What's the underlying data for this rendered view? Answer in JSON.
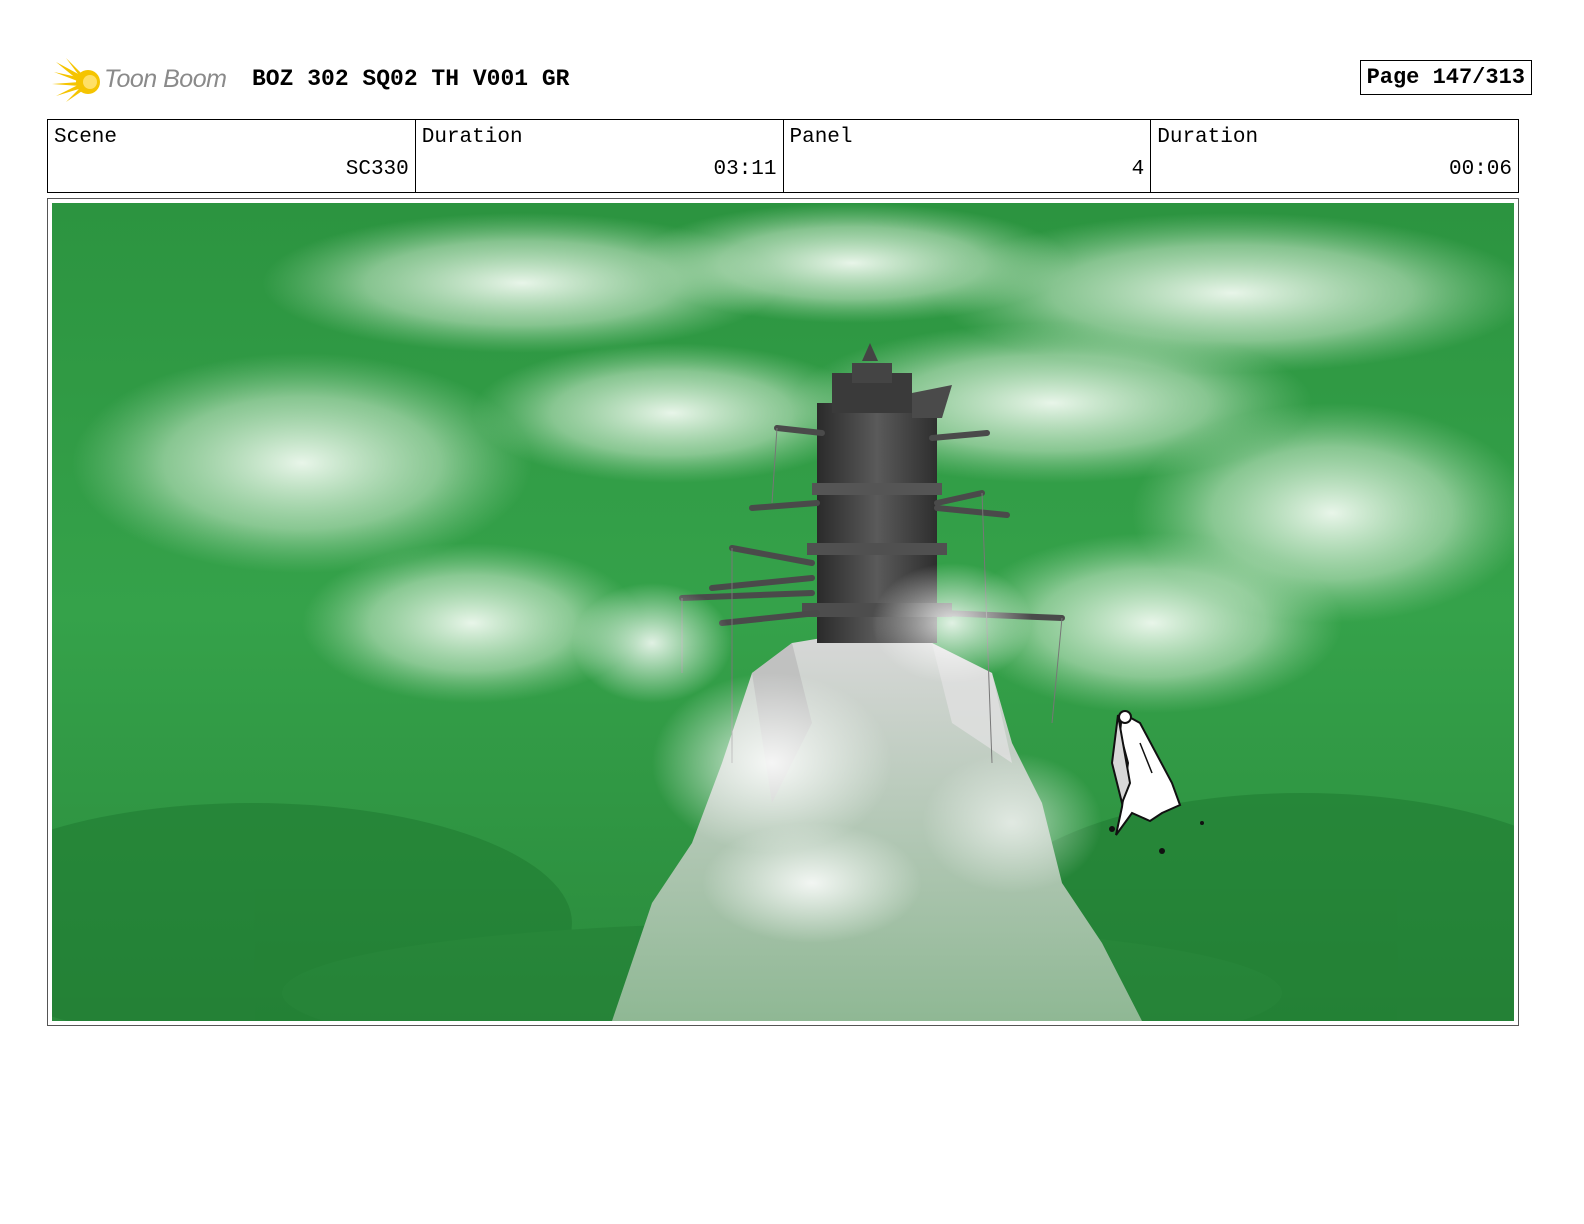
{
  "header": {
    "logo_text": "Toon Boom",
    "title": "BOZ 302 SQ02 TH V001 GR",
    "page": "Page 147/313"
  },
  "info": {
    "scene_label": "Scene",
    "scene_value": "SC330",
    "scene_duration_label": "Duration",
    "scene_duration_value": "03:11",
    "panel_label": "Panel",
    "panel_value": "4",
    "panel_duration_label": "Duration",
    "panel_duration_value": "00:06"
  },
  "colors": {
    "sky_green": "#2f9a45",
    "cloud_white": "#eaf5ea",
    "tower_gray": "#3a3a3a",
    "rock_gray": "#c9c9c9",
    "logo_yellow": "#f5c400"
  }
}
